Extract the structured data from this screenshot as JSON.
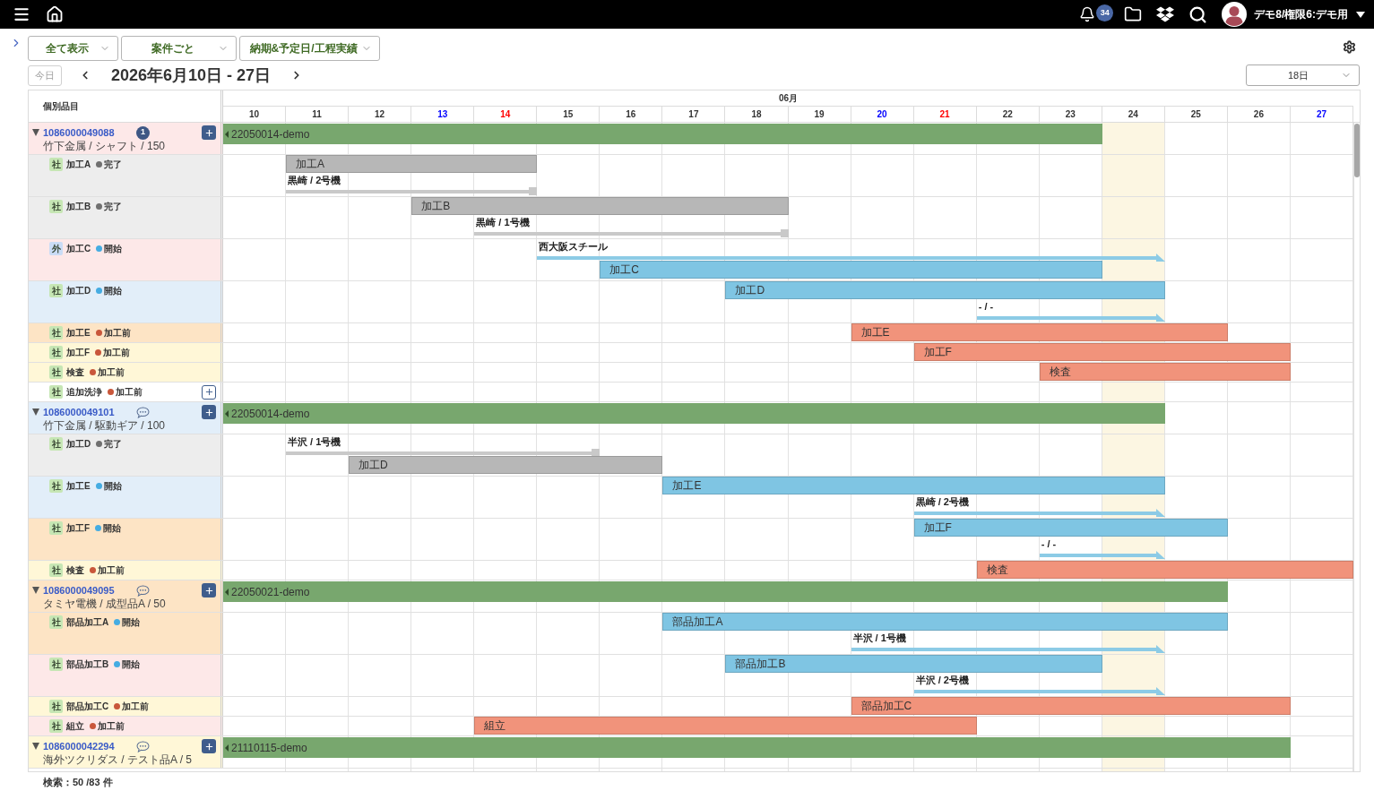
{
  "top_bar": {
    "notification_count": "34",
    "user_name": "デモ8/権限6:デモ用"
  },
  "filters": [
    {
      "label": "全て表示"
    },
    {
      "label": "案件ごと"
    },
    {
      "label": "納期&予定日/工程実績"
    }
  ],
  "date_nav": {
    "today_button": {
      "label": "今日",
      "disabled": true
    },
    "title": "2026年6月10日 - 27日",
    "range_select": {
      "value": "18日"
    }
  },
  "gantt": {
    "list_heading": "個別品目",
    "month": "06月",
    "days": [
      {
        "label": "10",
        "color": "#333333",
        "highlighted": false
      },
      {
        "label": "11",
        "color": "#333333",
        "highlighted": false
      },
      {
        "label": "12",
        "color": "#333333",
        "highlighted": false
      },
      {
        "label": "13",
        "color": "#0000ff",
        "highlighted": false
      },
      {
        "label": "14",
        "color": "#ff0000",
        "highlighted": false
      },
      {
        "label": "15",
        "color": "#333333",
        "highlighted": false
      },
      {
        "label": "16",
        "color": "#333333",
        "highlighted": false
      },
      {
        "label": "17",
        "color": "#333333",
        "highlighted": false
      },
      {
        "label": "18",
        "color": "#333333",
        "highlighted": false
      },
      {
        "label": "19",
        "color": "#333333",
        "highlighted": false
      },
      {
        "label": "20",
        "color": "#0000ff",
        "highlighted": false
      },
      {
        "label": "21",
        "color": "#ff0000",
        "highlighted": false
      },
      {
        "label": "22",
        "color": "#333333",
        "highlighted": false
      },
      {
        "label": "23",
        "color": "#333333",
        "highlighted": false
      },
      {
        "label": "24",
        "color": "#333333",
        "highlighted": true
      },
      {
        "label": "25",
        "color": "#333333",
        "highlighted": false
      },
      {
        "label": "26",
        "color": "#333333",
        "highlighted": false
      },
      {
        "label": "27",
        "color": "#0000ff",
        "highlighted": false
      }
    ],
    "orders": [
      {
        "number": "1086000049088",
        "comment_count": "1",
        "subtitle": "竹下金属 / シャフト / 150",
        "expanded": true,
        "color": "#fde8e8",
        "bar": {
          "label": "22050014-demo",
          "color": "#78a76e"
        },
        "tasks": [
          {
            "badge": {
              "label": "社",
              "color": "#c6e6b4"
            },
            "name": "加工A",
            "status": {
              "label": "完了",
              "color": "#707070"
            },
            "color": "#ededed",
            "timeline": [
              {
                "kind": "block",
                "label": "加工A",
                "color": "#b7b7b7"
              },
              {
                "kind": "line",
                "caption": "黒崎 / 2号機",
                "color": "#c9c9c9"
              }
            ]
          },
          {
            "badge": {
              "label": "社",
              "color": "#c6e6b4"
            },
            "name": "加工B",
            "status": {
              "label": "完了",
              "color": "#707070"
            },
            "color": "#ededed",
            "timeline": [
              {
                "kind": "block",
                "label": "加工B",
                "color": "#b7b7b7"
              },
              {
                "kind": "line",
                "caption": "黒崎 / 1号機",
                "color": "#c9c9c9"
              }
            ]
          },
          {
            "badge": {
              "label": "外",
              "color": "#cadcf6"
            },
            "name": "加工C",
            "status": {
              "label": "開始",
              "color": "#45ace2"
            },
            "color": "#fde8e8",
            "timeline": [
              {
                "kind": "arrow",
                "caption": "西大阪スチール",
                "color": "#8ccbe6"
              },
              {
                "kind": "block",
                "label": "加工C",
                "color": "#7fc5e3"
              }
            ]
          },
          {
            "badge": {
              "label": "社",
              "color": "#c6e6b4"
            },
            "name": "加工D",
            "status": {
              "label": "開始",
              "color": "#45ace2"
            },
            "color": "#e2eef9",
            "timeline": [
              {
                "kind": "block",
                "label": "加工D",
                "color": "#7fc5e3"
              },
              {
                "kind": "arrow",
                "caption": "- / -",
                "color": "#8ccbe6"
              }
            ]
          },
          {
            "badge": {
              "label": "社",
              "color": "#c6e6b4"
            },
            "name": "加工E",
            "status": {
              "label": "加工前",
              "color": "#c9573b"
            },
            "color": "#fde4c5",
            "timeline": [
              {
                "kind": "block",
                "label": "加工E",
                "color": "#f1937b"
              }
            ]
          },
          {
            "badge": {
              "label": "社",
              "color": "#c6e6b4"
            },
            "name": "加工F",
            "status": {
              "label": "加工前",
              "color": "#c9573b"
            },
            "color": "#fff7d7",
            "timeline": [
              {
                "kind": "block",
                "label": "加工F",
                "color": "#f1937b"
              }
            ]
          },
          {
            "badge": {
              "label": "社",
              "color": "#c6e6b4"
            },
            "name": "検査",
            "status": {
              "label": "加工前",
              "color": "#c9573b"
            },
            "color": "#fff7d7",
            "timeline": [
              {
                "kind": "block",
                "label": "検査",
                "color": "#f1937b"
              }
            ]
          },
          {
            "badge": {
              "label": "社",
              "color": "#c6e6b4"
            },
            "name": "追加洗浄",
            "status": {
              "label": "加工前",
              "color": "#c9573b"
            },
            "color": "#ffffff",
            "add_button": true
          }
        ]
      },
      {
        "number": "1086000049101",
        "subtitle": "竹下金属 / 駆動ギア / 100",
        "expanded": true,
        "color": "#e2eef9",
        "bar": {
          "label": "22050014-demo",
          "color": "#78a76e"
        },
        "tasks": [
          {
            "badge": {
              "label": "社",
              "color": "#c6e6b4"
            },
            "name": "加工D",
            "status": {
              "label": "完了",
              "color": "#707070"
            },
            "color": "#ededed",
            "timeline": [
              {
                "kind": "line",
                "caption": "半沢 / 1号機",
                "color": "#c9c9c9"
              },
              {
                "kind": "block",
                "label": "加工D",
                "color": "#b7b7b7"
              }
            ]
          },
          {
            "badge": {
              "label": "社",
              "color": "#c6e6b4"
            },
            "name": "加工E",
            "status": {
              "label": "開始",
              "color": "#45ace2"
            },
            "color": "#e2eef9",
            "timeline": [
              {
                "kind": "block",
                "label": "加工E",
                "color": "#7fc5e3"
              },
              {
                "kind": "arrow",
                "caption": "黒崎 / 2号機",
                "color": "#8ccbe6"
              }
            ]
          },
          {
            "badge": {
              "label": "社",
              "color": "#c6e6b4"
            },
            "name": "加工F",
            "status": {
              "label": "開始",
              "color": "#45ace2"
            },
            "color": "#fde4c5",
            "timeline": [
              {
                "kind": "block",
                "label": "加工F",
                "color": "#7fc5e3"
              },
              {
                "kind": "arrow",
                "caption": "- / -",
                "color": "#8ccbe6"
              }
            ]
          },
          {
            "badge": {
              "label": "社",
              "color": "#c6e6b4"
            },
            "name": "検査",
            "status": {
              "label": "加工前",
              "color": "#c9573b"
            },
            "color": "#fff7d7",
            "timeline": [
              {
                "kind": "block",
                "label": "検査",
                "color": "#f1937b"
              }
            ]
          }
        ]
      },
      {
        "number": "1086000049095",
        "subtitle": "タミヤ電機 / 成型品A / 50",
        "expanded": true,
        "color": "#fde4c5",
        "bar": {
          "label": "22050021-demo",
          "color": "#78a76e"
        },
        "tasks": [
          {
            "badge": {
              "label": "社",
              "color": "#c6e6b4"
            },
            "name": "部品加工A",
            "status": {
              "label": "開始",
              "color": "#45ace2"
            },
            "color": "#fde4c5",
            "timeline": [
              {
                "kind": "block",
                "label": "部品加工A",
                "color": "#7fc5e3"
              },
              {
                "kind": "arrow",
                "caption": "半沢 / 1号機",
                "color": "#8ccbe6"
              }
            ]
          },
          {
            "badge": {
              "label": "社",
              "color": "#c6e6b4"
            },
            "name": "部品加工B",
            "status": {
              "label": "開始",
              "color": "#45ace2"
            },
            "color": "#fde8e8",
            "timeline": [
              {
                "kind": "block",
                "label": "部品加工B",
                "color": "#7fc5e3"
              },
              {
                "kind": "arrow",
                "caption": "半沢 / 2号機",
                "color": "#8ccbe6"
              }
            ]
          },
          {
            "badge": {
              "label": "社",
              "color": "#c6e6b4"
            },
            "name": "部品加工C",
            "status": {
              "label": "加工前",
              "color": "#c9573b"
            },
            "color": "#fff7d7",
            "timeline": [
              {
                "kind": "block",
                "label": "部品加工C",
                "color": "#f1937b"
              }
            ]
          },
          {
            "badge": {
              "label": "社",
              "color": "#c6e6b4"
            },
            "name": "組立",
            "status": {
              "label": "加工前",
              "color": "#c9573b"
            },
            "color": "#fde8e8",
            "timeline": [
              {
                "kind": "block",
                "label": "組立",
                "color": "#f1937b"
              }
            ]
          }
        ]
      },
      {
        "number": "1086000042294",
        "subtitle": "海外ツクリダス / テスト品A / 5",
        "expanded": true,
        "color": "#fff7d7",
        "bar": {
          "label": "21110115-demo",
          "color": "#78a76e"
        }
      }
    ]
  },
  "footer": {
    "search_count": "検索：50 /83 件"
  }
}
